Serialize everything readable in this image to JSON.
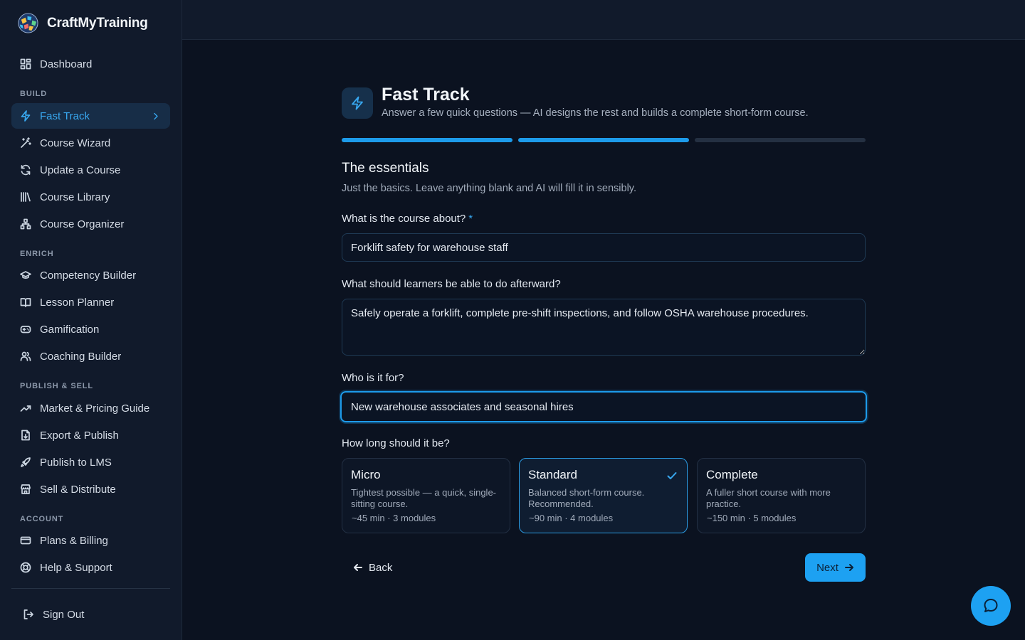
{
  "app": {
    "name": "CraftMyTraining",
    "accent": "#1da1f2"
  },
  "sidebar": {
    "dashboard": "Dashboard",
    "sections": {
      "build": "BUILD",
      "enrich": "ENRICH",
      "publish": "PUBLISH & SELL",
      "account": "ACCOUNT"
    },
    "items": {
      "fast_track": "Fast Track",
      "course_wizard": "Course Wizard",
      "update_course": "Update a Course",
      "course_library": "Course Library",
      "course_organizer": "Course Organizer",
      "competency_builder": "Competency Builder",
      "lesson_planner": "Lesson Planner",
      "gamification": "Gamification",
      "coaching_builder": "Coaching Builder",
      "market_pricing": "Market & Pricing Guide",
      "export_publish": "Export & Publish",
      "publish_lms": "Publish to LMS",
      "sell_distribute": "Sell & Distribute",
      "plans_billing": "Plans & Billing",
      "help_support": "Help & Support"
    },
    "sign_out": "Sign Out"
  },
  "header": {
    "title": "Fast Track",
    "subtitle": "Answer a few quick questions — AI designs the rest and builds a complete short-form course."
  },
  "progress": {
    "current_step": 2,
    "total_steps": 3
  },
  "step": {
    "title": "The essentials",
    "subtitle": "Just the basics. Leave anything blank and AI will fill it in sensibly."
  },
  "form": {
    "topic": {
      "label": "What is the course about?",
      "required": "*",
      "value": "Forklift safety for warehouse staff"
    },
    "outcome": {
      "label": "What should learners be able to do afterward?",
      "value": "Safely operate a forklift, complete pre-shift inspections, and follow OSHA warehouse procedures."
    },
    "audience": {
      "label": "Who is it for?",
      "value": "New warehouse associates and seasonal hires"
    },
    "length": {
      "label": "How long should it be?",
      "selected": "Standard",
      "options": [
        {
          "title": "Micro",
          "desc": "Tightest possible — a quick, single-sitting course.",
          "meta": "~45 min · 3 modules"
        },
        {
          "title": "Standard",
          "desc": "Balanced short-form course. Recommended.",
          "meta": "~90 min · 4 modules"
        },
        {
          "title": "Complete",
          "desc": "A fuller short course with more practice.",
          "meta": "~150 min · 5 modules"
        }
      ]
    }
  },
  "actions": {
    "back": "Back",
    "next": "Next"
  },
  "icons": {
    "chat": "chat-bubble-icon",
    "header": "lightning-icon"
  }
}
